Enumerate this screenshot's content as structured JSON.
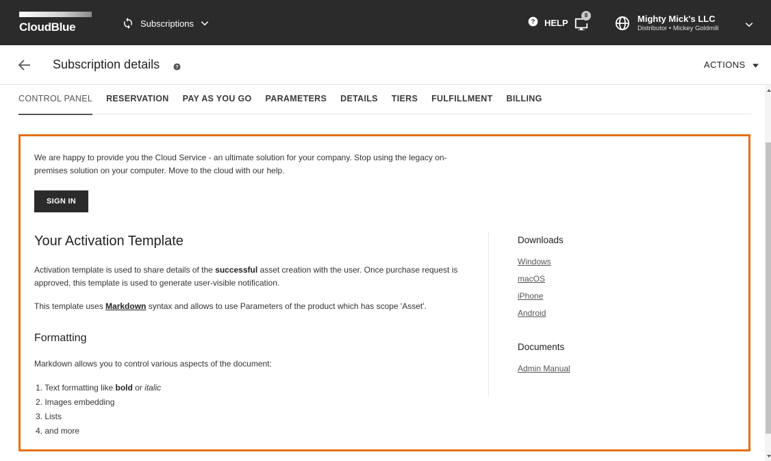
{
  "topbar": {
    "logo": "CloudBlue",
    "module_label": "Subscriptions",
    "help_label": "HELP",
    "notification_count": "8",
    "account_name": "Mighty Mick's LLC",
    "account_role": "Distributor • Mickey Goldmill"
  },
  "header": {
    "title": "Subscription details",
    "actions_label": "ACTIONS"
  },
  "tabs": [
    {
      "label": "CONTROL PANEL",
      "active": true
    },
    {
      "label": "RESERVATION"
    },
    {
      "label": "PAY AS YOU GO"
    },
    {
      "label": "PARAMETERS"
    },
    {
      "label": "DETAILS"
    },
    {
      "label": "TIERS"
    },
    {
      "label": "FULFILLMENT"
    },
    {
      "label": "BILLING"
    }
  ],
  "content": {
    "intro": "We are happy to provide you the Cloud Service - an ultimate solution for your company. Stop using the legacy on-premises solution on your computer. Move to the cloud with our help.",
    "signin_label": "SIGN IN",
    "activation_title": "Your Activation Template",
    "activation_desc_1": "Activation template is used to share details of the ",
    "activation_desc_bold": "successful",
    "activation_desc_2": " asset creation with the user. Once purchase request is approved, this template is used to generate user-visible notification.",
    "template_note_1": "This template uses ",
    "template_note_link": "Markdown",
    "template_note_2": " syntax and allows to use Parameters of the product which has scope 'Asset'.",
    "formatting_title": "Formatting",
    "formatting_desc": "Markdown allows you to control various aspects of the document:",
    "list_1_prefix": "1. Text formatting like ",
    "list_1_bold": "bold",
    "list_1_mid": " or ",
    "list_1_italic": "italic",
    "list_2": "2. Images embedding",
    "list_3": "3. Lists",
    "list_4": "4. and more"
  },
  "sidebar": {
    "downloads_title": "Downloads",
    "downloads": [
      "Windows",
      "macOS",
      "iPhone",
      "Android"
    ],
    "documents_title": "Documents",
    "documents": [
      "Admin Manual"
    ]
  },
  "colors": {
    "topbar_bg": "#2b2b2b",
    "highlight_border": "#e66f13",
    "primary_button": "#2b2b2b"
  },
  "icons": [
    "sync-icon",
    "chevron-down-icon",
    "help-icon",
    "notification-icon",
    "globe-icon",
    "arrow-back-icon",
    "caret-down-icon"
  ]
}
